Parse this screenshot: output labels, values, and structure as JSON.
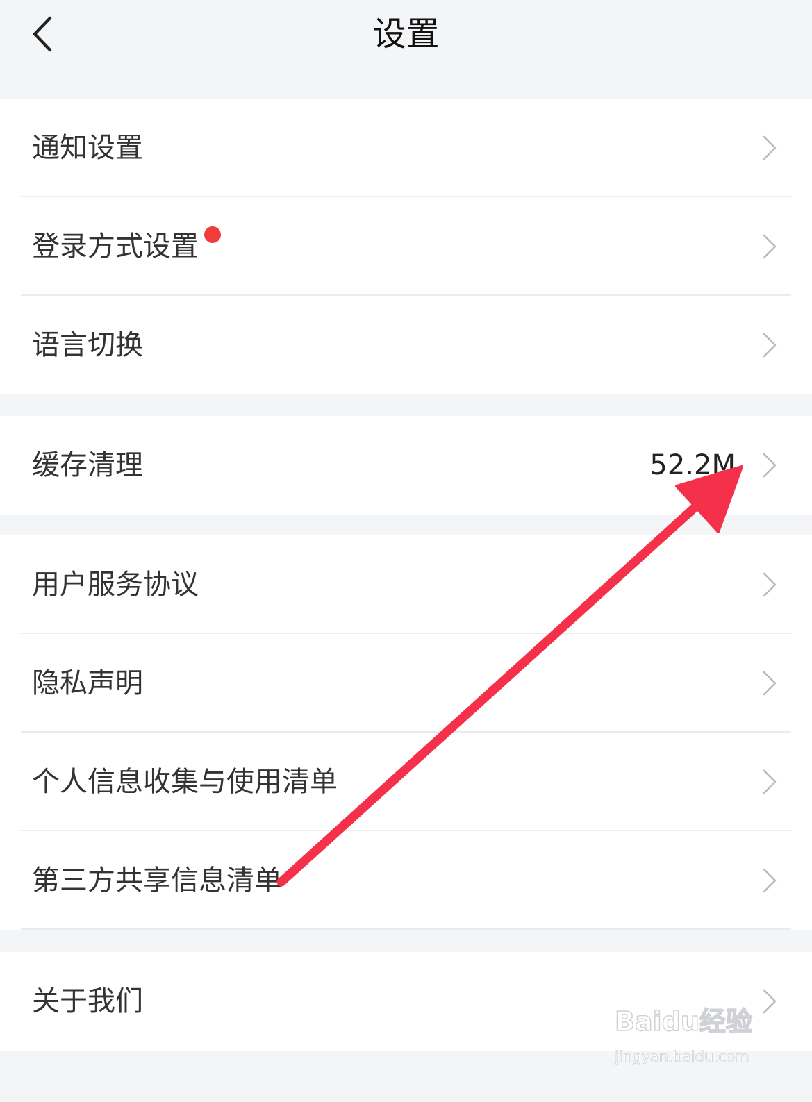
{
  "header": {
    "title": "设置",
    "back_icon": "chevron-left-icon"
  },
  "groups": [
    {
      "items": [
        {
          "label": "通知设置"
        },
        {
          "label": "登录方式设置",
          "badge": "red-dot"
        },
        {
          "label": "语言切换"
        }
      ]
    },
    {
      "items": [
        {
          "label": "缓存清理",
          "value": "52.2M"
        }
      ]
    },
    {
      "items": [
        {
          "label": "用户服务协议"
        },
        {
          "label": "隐私声明"
        },
        {
          "label": "个人信息收集与使用清单"
        },
        {
          "label": "第三方共享信息清单"
        }
      ]
    },
    {
      "items": [
        {
          "label": "关于我们"
        }
      ]
    }
  ],
  "annotation": {
    "arrow_color": "#f5304a"
  },
  "watermark": {
    "logo": "Baidu经验",
    "url": "jingyan.baidu.com"
  },
  "colors": {
    "background": "#f4f5f7",
    "card": "#ffffff",
    "badge": "#f23c3c"
  }
}
